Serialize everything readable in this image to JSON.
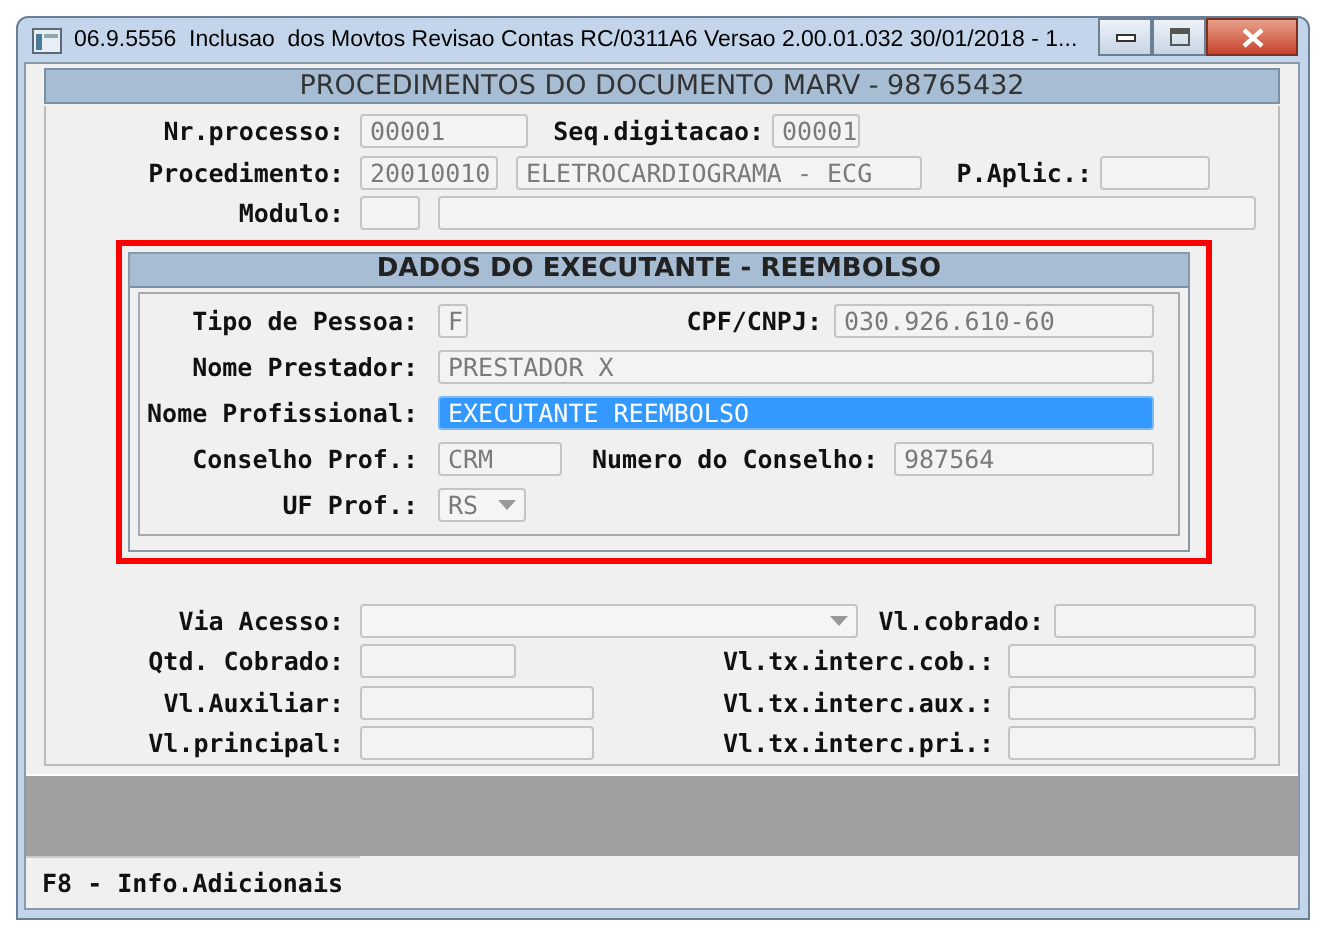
{
  "window": {
    "title": "06.9.5556  Inclusao  dos Movtos Revisao Contas RC/0311A6 Versao 2.00.01.032 30/01/2018 - 1..."
  },
  "form": {
    "title": "PROCEDIMENTOS DO DOCUMENTO MARV - 98765432",
    "rows": [
      {
        "items": [
          {
            "kind": "label",
            "text": "Nr.processo:"
          },
          {
            "kind": "field",
            "value": "00001"
          },
          {
            "kind": "label",
            "text": "Seq.digitacao:"
          },
          {
            "kind": "field",
            "value": "00001"
          }
        ]
      },
      {
        "items": [
          {
            "kind": "label",
            "text": "Procedimento:"
          },
          {
            "kind": "field",
            "value": "20010010"
          },
          {
            "kind": "field",
            "value": "ELETROCARDIOGRAMA - ECG"
          },
          {
            "kind": "label",
            "text": "P.Aplic.:"
          },
          {
            "kind": "field"
          }
        ]
      },
      {
        "items": [
          {
            "kind": "label",
            "text": "Modulo:"
          },
          {
            "kind": "field"
          },
          {
            "kind": "field"
          }
        ]
      },
      {
        "items": [
          {
            "kind": "label",
            "text": "Via Acesso:"
          },
          {
            "kind": "dropdown"
          },
          {
            "kind": "label",
            "text": "Vl.cobrado:"
          },
          {
            "kind": "field"
          }
        ]
      },
      {
        "items": [
          {
            "kind": "label",
            "text": "Qtd. Cobrado:"
          },
          {
            "kind": "field"
          },
          {
            "kind": "label",
            "text": "Vl.tx.interc.cob.:"
          },
          {
            "kind": "field"
          }
        ]
      },
      {
        "items": [
          {
            "kind": "label",
            "text": "Vl.Auxiliar:"
          },
          {
            "kind": "field"
          },
          {
            "kind": "label",
            "text": "Vl.tx.interc.aux.:"
          },
          {
            "kind": "field"
          }
        ]
      },
      {
        "items": [
          {
            "kind": "label",
            "text": "Vl.principal:"
          },
          {
            "kind": "field"
          },
          {
            "kind": "label",
            "text": "Vl.tx.interc.pri.:"
          },
          {
            "kind": "field"
          }
        ]
      }
    ]
  },
  "dialog": {
    "title": "DADOS DO EXECUTANTE - REEMBOLSO",
    "rows": [
      {
        "items": [
          {
            "kind": "label",
            "text": "Tipo de Pessoa:"
          },
          {
            "kind": "field",
            "value": "F",
            "selected": false
          },
          {
            "kind": "label",
            "text": "CPF/CNPJ:"
          },
          {
            "kind": "field",
            "value": "030.926.610-60",
            "selected": false
          }
        ]
      },
      {
        "items": [
          {
            "kind": "label",
            "text": "Nome Prestador:"
          },
          {
            "kind": "field",
            "value": "PRESTADOR X",
            "selected": false
          }
        ]
      },
      {
        "items": [
          {
            "kind": "label",
            "text": "Nome Profissional:"
          },
          {
            "kind": "field",
            "value": "EXECUTANTE REEMBOLSO",
            "selected": true
          }
        ]
      },
      {
        "items": [
          {
            "kind": "label",
            "text": "Conselho Prof.:"
          },
          {
            "kind": "field",
            "value": "CRM",
            "selected": false
          },
          {
            "kind": "label",
            "text": "Numero do Conselho:"
          },
          {
            "kind": "field",
            "value": "987564",
            "selected": false
          }
        ]
      },
      {
        "items": [
          {
            "kind": "label",
            "text": "UF Prof.:"
          },
          {
            "kind": "dropdown",
            "value": "RS",
            "selected": false
          }
        ]
      }
    ]
  },
  "status_bar": {
    "text": "F8 - Info.Adicionais"
  }
}
